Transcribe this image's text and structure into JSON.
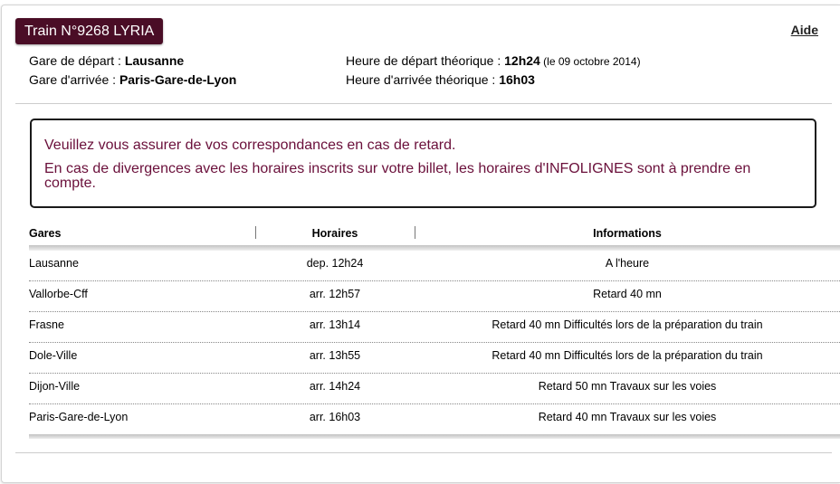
{
  "header": {
    "train_label": "Train N°9268 LYRIA",
    "help_link": "Aide"
  },
  "journey": {
    "depart_label": "Gare de départ : ",
    "depart_value": "Lausanne",
    "arrivee_label": "Gare d'arrivée : ",
    "arrivee_value": "Paris-Gare-de-Lyon",
    "heure_depart_label": "Heure de départ théorique : ",
    "heure_depart_value": "12h24",
    "heure_depart_date": " (le 09 octobre 2014)",
    "heure_arrivee_label": "Heure d'arrivée théorique : ",
    "heure_arrivee_value": "16h03"
  },
  "notice": {
    "line1": "Veuillez vous assurer de vos correspondances en cas de retard.",
    "line2": "En cas de divergences avec les horaires inscrits sur votre billet, les horaires d'INFOLIGNES sont à prendre en compte."
  },
  "table": {
    "columns": [
      "Gares",
      "Horaires",
      "Informations"
    ],
    "rows": [
      {
        "gare": "Lausanne",
        "horaire": "dep. 12h24",
        "info": "A l'heure"
      },
      {
        "gare": "Vallorbe-Cff",
        "horaire": "arr. 12h57",
        "info": "Retard 40 mn"
      },
      {
        "gare": "Frasne",
        "horaire": "arr. 13h14",
        "info": "Retard 40 mn Difficultés lors de la préparation du train"
      },
      {
        "gare": "Dole-Ville",
        "horaire": "arr. 13h55",
        "info": "Retard 40 mn Difficultés lors de la préparation du train"
      },
      {
        "gare": "Dijon-Ville",
        "horaire": "arr. 14h24",
        "info": "Retard 50 mn Travaux sur les voies"
      },
      {
        "gare": "Paris-Gare-de-Lyon",
        "horaire": "arr. 16h03",
        "info": "Retard 40 mn Travaux sur les voies"
      }
    ]
  },
  "colors": {
    "badge_bg": "#4a0d26",
    "notice_text": "#6a0f3a"
  }
}
